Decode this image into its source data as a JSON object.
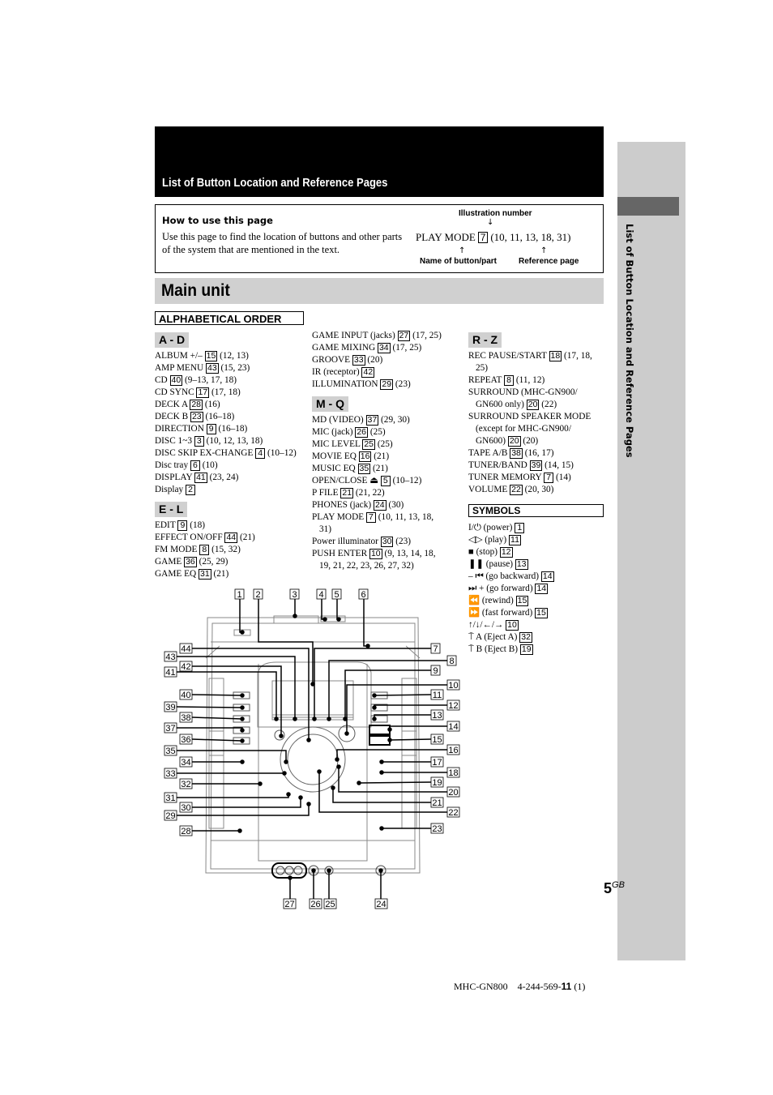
{
  "header": {
    "title": "List of Button Location and Reference Pages"
  },
  "how_to": {
    "title": "How to use this page",
    "text": "Use this page to find the location of buttons and other parts of the system that are mentioned in the text.",
    "legend": {
      "illustration_label": "Illustration number",
      "example_name": "PLAY MODE",
      "example_number": "7",
      "example_pages": "(10, 11, 13, 18, 31)",
      "name_label": "Name of button/part",
      "page_label": "Reference page"
    }
  },
  "section_title": "Main unit",
  "alpha_heading": "ALPHABETICAL ORDER",
  "groups": {
    "ad": {
      "label": "A - D",
      "items": [
        {
          "name": "ALBUM +/–",
          "num": "15",
          "pages": "(12, 13)"
        },
        {
          "name": "AMP MENU",
          "num": "43",
          "pages": "(15, 23)"
        },
        {
          "name": "CD",
          "num": "40",
          "pages": "(9–13, 17, 18)"
        },
        {
          "name": "CD SYNC",
          "num": "17",
          "pages": "(17, 18)"
        },
        {
          "name": "DECK A",
          "num": "28",
          "pages": "(16)"
        },
        {
          "name": "DECK B",
          "num": "23",
          "pages": "(16–18)"
        },
        {
          "name": "DIRECTION",
          "num": "9",
          "pages": "(16–18)"
        },
        {
          "name": "DISC 1~3",
          "num": "3",
          "pages": "(10, 12, 13, 18)"
        },
        {
          "name": "DISC SKIP EX-CHANGE",
          "num": "4",
          "pages": "(10–12)"
        },
        {
          "name": "Disc tray",
          "num": "6",
          "pages": "(10)"
        },
        {
          "name": "DISPLAY",
          "num": "41",
          "pages": "(23, 24)"
        },
        {
          "name": "Display",
          "num": "2",
          "pages": ""
        }
      ]
    },
    "el": {
      "label": "E - L",
      "items": [
        {
          "name": "EDIT",
          "num": "9",
          "pages": "(18)"
        },
        {
          "name": "EFFECT ON/OFF",
          "num": "44",
          "pages": "(21)"
        },
        {
          "name": "FM MODE",
          "num": "8",
          "pages": "(15, 32)"
        },
        {
          "name": "GAME",
          "num": "36",
          "pages": "(25, 29)"
        },
        {
          "name": "GAME EQ",
          "num": "31",
          "pages": "(21)"
        },
        {
          "name": "GAME INPUT (jacks)",
          "num": "27",
          "pages": "(17, 25)"
        },
        {
          "name": "GAME MIXING",
          "num": "34",
          "pages": "(17, 25)"
        },
        {
          "name": "GROOVE",
          "num": "33",
          "pages": "(20)"
        },
        {
          "name": "IR (receptor)",
          "num": "42",
          "pages": ""
        },
        {
          "name": "ILLUMINATION",
          "num": "29",
          "pages": "(23)"
        }
      ]
    },
    "mq": {
      "label": "M - Q",
      "items": [
        {
          "name": "MD (VIDEO)",
          "num": "37",
          "pages": "(29, 30)"
        },
        {
          "name": "MIC (jack)",
          "num": "26",
          "pages": "(25)"
        },
        {
          "name": "MIC LEVEL",
          "num": "25",
          "pages": "(25)"
        },
        {
          "name": "MOVIE EQ",
          "num": "16",
          "pages": "(21)"
        },
        {
          "name": "MUSIC EQ",
          "num": "35",
          "pages": "(21)"
        },
        {
          "name": "OPEN/CLOSE ⏏",
          "num": "5",
          "pages": "(10–12)"
        },
        {
          "name": "P FILE",
          "num": "21",
          "pages": "(21, 22)"
        },
        {
          "name": "PHONES (jack)",
          "num": "24",
          "pages": "(30)"
        },
        {
          "name": "PLAY MODE",
          "num": "7",
          "pages": "(10, 11, 13, 18,",
          "cont": "31)"
        },
        {
          "name": "Power illuminator",
          "num": "30",
          "pages": "(23)"
        },
        {
          "name": "PUSH ENTER",
          "num": "10",
          "pages": "(9, 13, 14, 18,",
          "cont": "19, 21, 22, 23, 26, 27, 32)"
        }
      ]
    },
    "rz": {
      "label": "R - Z",
      "items": [
        {
          "name": "REC PAUSE/START",
          "num": "18",
          "pages": "(17, 18,",
          "cont": "25)"
        },
        {
          "name": "REPEAT",
          "num": "8",
          "pages": "(11, 12)"
        },
        {
          "name": "SURROUND (MHC-GN900/",
          "num": "",
          "pages": "",
          "cont_pre": "GN600 only)",
          "cont_num": "20",
          "cont": "(22)"
        },
        {
          "name": "SURROUND SPEAKER MODE",
          "num": "",
          "pages": "",
          "cont_pre": "(except for MHC-GN900/",
          "cont_pre2": "GN600)",
          "cont_num": "20",
          "cont": "(20)"
        },
        {
          "name": "TAPE A/B",
          "num": "38",
          "pages": "(16, 17)"
        },
        {
          "name": "TUNER/BAND",
          "num": "39",
          "pages": "(14, 15)"
        },
        {
          "name": "TUNER MEMORY",
          "num": "7",
          "pages": "(14)"
        },
        {
          "name": "VOLUME",
          "num": "22",
          "pages": "(20, 30)"
        }
      ]
    }
  },
  "symbols": {
    "heading": "SYMBOLS",
    "items": [
      {
        "glyph": "I/⏻",
        "name": "(power)",
        "num": "1"
      },
      {
        "glyph": "◁▷",
        "name": "(play)",
        "num": "11"
      },
      {
        "glyph": "■",
        "name": "(stop)",
        "num": "12"
      },
      {
        "glyph": "❚❚",
        "name": "(pause)",
        "num": "13"
      },
      {
        "glyph": "– ⏮",
        "name": "(go backward)",
        "num": "14"
      },
      {
        "glyph": "⏭",
        "name": "+ (go forward)",
        "num": "14"
      },
      {
        "glyph": "⏪",
        "name": "(rewind)",
        "num": "15"
      },
      {
        "glyph": "⏩",
        "name": "(fast forward)",
        "num": "15"
      },
      {
        "glyph": "↑/↓/←/→",
        "name": "",
        "num": "10"
      },
      {
        "glyph": "⍑",
        "name": "A (Eject A)",
        "num": "32"
      },
      {
        "glyph": "⍑",
        "name": "B (Eject B)",
        "num": "19"
      }
    ]
  },
  "side_tab": {
    "text": "List of Button Location and Reference Pages"
  },
  "page_number": {
    "num": "5",
    "suffix": "GB"
  },
  "footer": {
    "model": "MHC-GN800",
    "code_prefix": "4-244-569-",
    "code_bold": "11",
    "code_suffix": "(1)"
  },
  "diagram": {
    "callouts_top": [
      "1",
      "2",
      "3",
      "4",
      "5",
      "6"
    ],
    "callouts_left": [
      "44",
      "43",
      "42",
      "41",
      "40",
      "39",
      "38",
      "37",
      "36",
      "35",
      "34",
      "33",
      "32",
      "31",
      "30",
      "29",
      "28"
    ],
    "callouts_right": [
      "7",
      "8",
      "9",
      "10",
      "11",
      "12",
      "13",
      "14",
      "15",
      "16",
      "17",
      "18",
      "19",
      "20",
      "21",
      "22",
      "23"
    ],
    "callouts_bottom": [
      "27",
      "26",
      "25",
      "24"
    ]
  }
}
